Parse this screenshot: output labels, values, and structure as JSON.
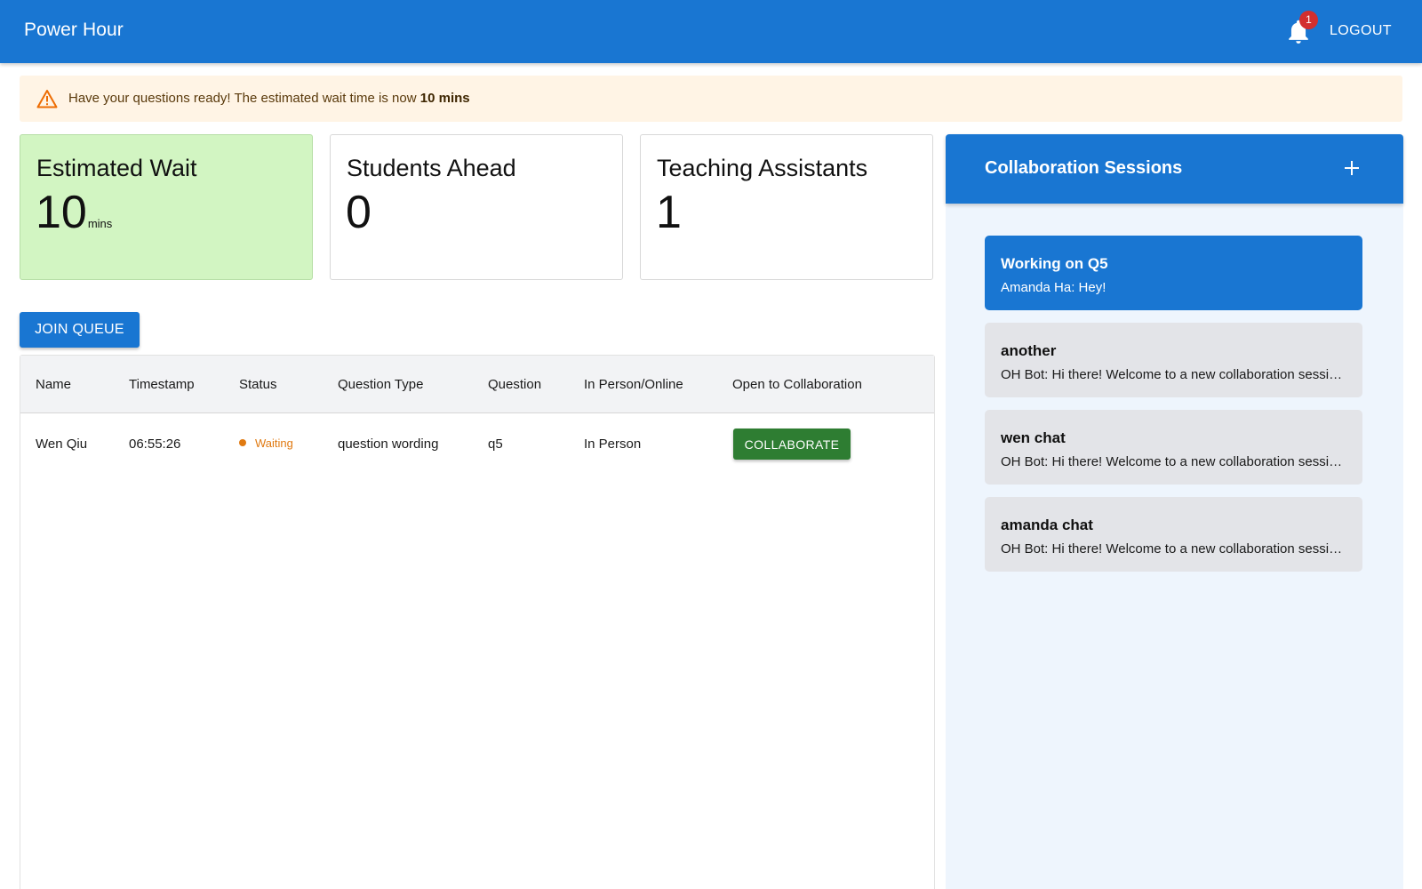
{
  "app": {
    "title": "Power Hour",
    "notification_count": "1",
    "logout_label": "LOGOUT"
  },
  "alert": {
    "message_prefix": "Have your questions ready! The estimated wait time is now ",
    "message_bold": "10 mins"
  },
  "stats": {
    "estimated_wait": {
      "title": "Estimated Wait",
      "value": "10",
      "unit": "mins"
    },
    "students_ahead": {
      "title": "Students Ahead",
      "value": "0"
    },
    "teaching_assistants": {
      "title": "Teaching Assistants",
      "value": "1"
    }
  },
  "queue": {
    "join_label": "JOIN QUEUE",
    "columns": [
      "Name",
      "Timestamp",
      "Status",
      "Question Type",
      "Question",
      "In Person/Online",
      "Open to Collaboration"
    ],
    "rows": [
      {
        "name": "Wen Qiu",
        "timestamp": "06:55:26",
        "status": "Waiting",
        "question_type": "question wording",
        "question": "q5",
        "mode": "In Person",
        "collaborate_label": "COLLABORATE"
      }
    ]
  },
  "collaboration": {
    "title": "Collaboration Sessions",
    "sessions": [
      {
        "title": "Working on Q5",
        "preview": "Amanda Ha: Hey!",
        "active": true
      },
      {
        "title": "another",
        "preview": "OH Bot: Hi there! Welcome to a new collaboration session. Feel free to chat here.",
        "active": false
      },
      {
        "title": "wen chat",
        "preview": "OH Bot: Hi there! Welcome to a new collaboration session. Feel free to chat here.",
        "active": false
      },
      {
        "title": "amanda chat",
        "preview": "OH Bot: Hi there! Welcome to a new collaboration session. Feel free to chat here.",
        "active": false
      }
    ]
  },
  "colors": {
    "primary": "#1976d2",
    "success": "#2e7d32",
    "warning": "#e07a12",
    "alert_bg": "#fff4e5",
    "card_green": "#d2f5c2",
    "badge": "#d32f2f"
  },
  "icons": {
    "bell": "bell-icon",
    "warning": "warning-icon",
    "add": "plus-icon",
    "status": "status-dot"
  }
}
